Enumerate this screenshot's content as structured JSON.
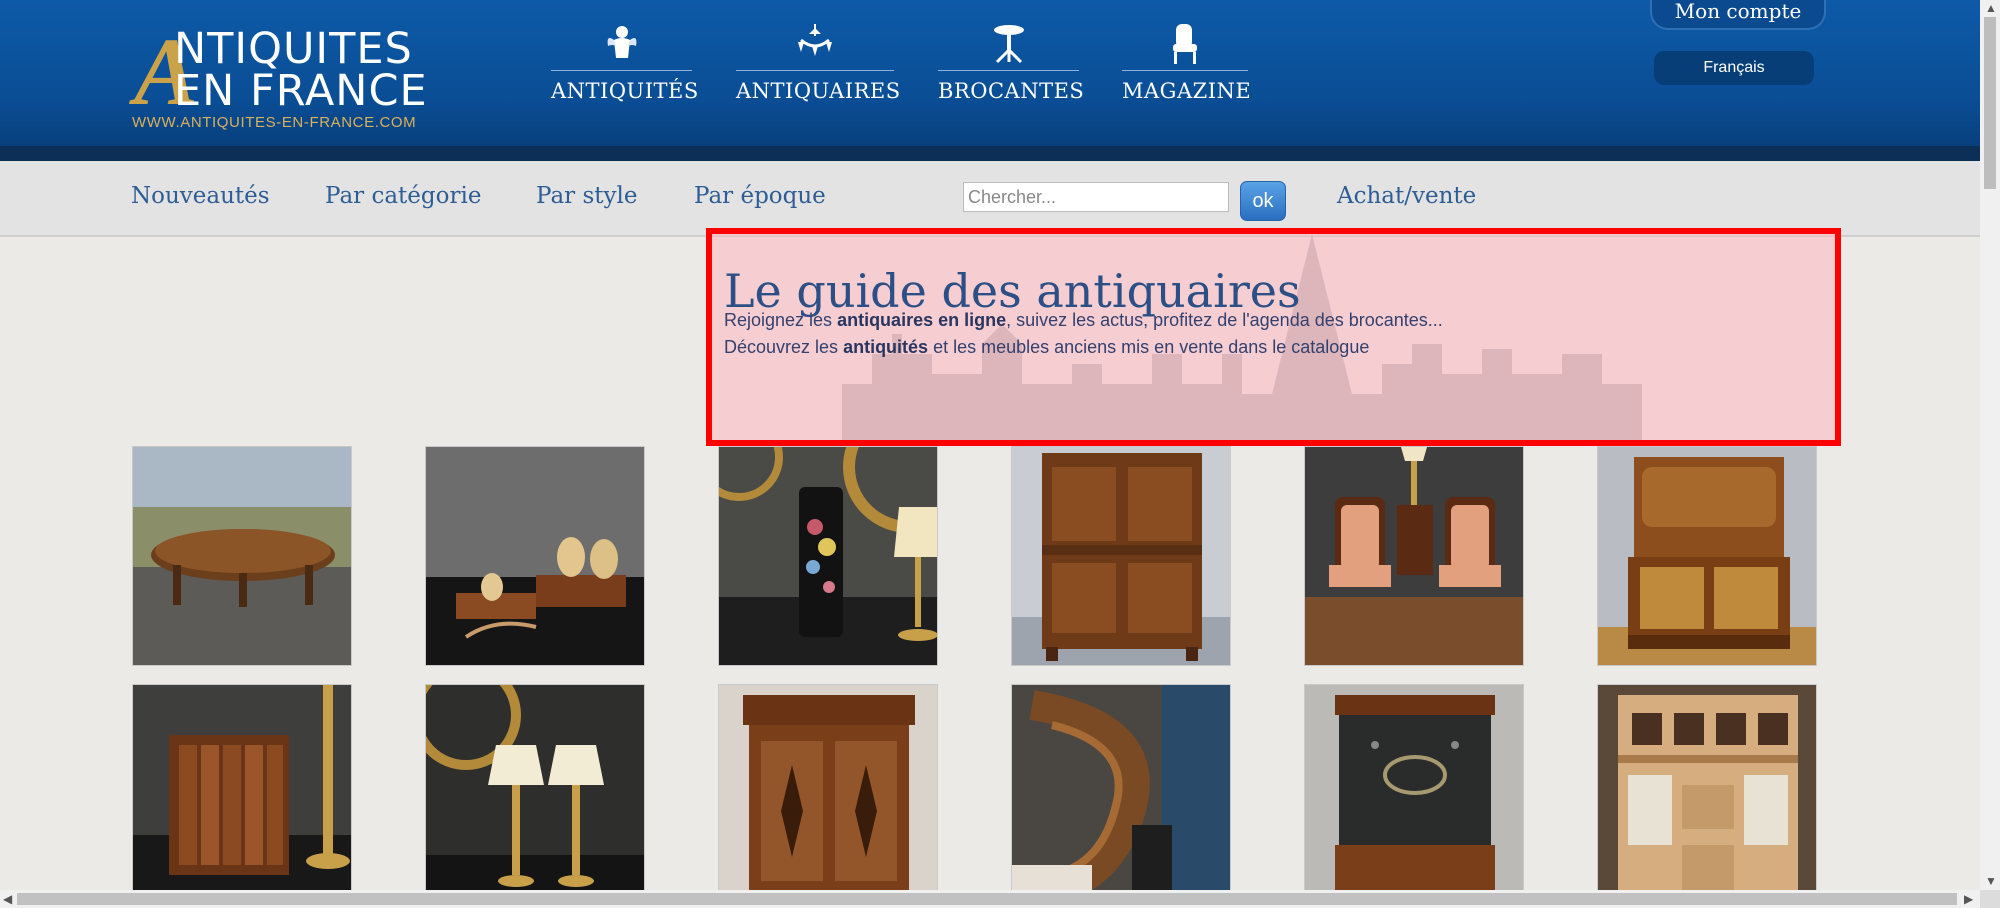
{
  "header": {
    "logo": {
      "line1": "NTIQUITES",
      "line2": "EN FRANCE",
      "url": "WWW.ANTIQUITES-EN-FRANCE.COM"
    },
    "nav": [
      {
        "label": "ANTIQUITÉS",
        "icon": "cherub-icon"
      },
      {
        "label": "ANTIQUAIRES",
        "icon": "chandelier-icon"
      },
      {
        "label": "BROCANTES",
        "icon": "gueridon-icon"
      },
      {
        "label": "MAGAZINE",
        "icon": "armchair-icon"
      }
    ],
    "account_label": "Mon compte",
    "language_label": "Français"
  },
  "subnav": {
    "links": [
      "Nouveautés",
      "Par catégorie",
      "Par style",
      "Par époque"
    ],
    "search_placeholder": "Chercher...",
    "search_button": "ok",
    "achat_vente": "Achat/vente"
  },
  "hero": {
    "title": "Le guide des antiquaires",
    "line1_a": "Rejoignez les ",
    "line1_b": "antiquaires en ligne",
    "line1_c": ", suivez les actus, profitez de l'agenda des brocantes...",
    "line2_a": "Découvrez les ",
    "line2_b": "antiquités",
    "line2_c": " et les meubles anciens mis en vente dans le catalogue"
  },
  "gallery": [
    {
      "name": "round-table-photo"
    },
    {
      "name": "egg-stands-photo"
    },
    {
      "name": "painted-vase-photo"
    },
    {
      "name": "oak-cabinet-photo"
    },
    {
      "name": "pair-armchairs-photo"
    },
    {
      "name": "cylinder-desk-photo"
    },
    {
      "name": "book-box-photo"
    },
    {
      "name": "pair-lamps-photo"
    },
    {
      "name": "carved-buffet-photo"
    },
    {
      "name": "spiral-staircase-photo"
    },
    {
      "name": "iron-safe-photo"
    },
    {
      "name": "display-cabinet-photo"
    }
  ],
  "colors": {
    "header_blue": "#0a4d94",
    "link_blue": "#2d5d94",
    "logo_gold": "#c9a24a",
    "highlight_border": "#ff0000"
  }
}
